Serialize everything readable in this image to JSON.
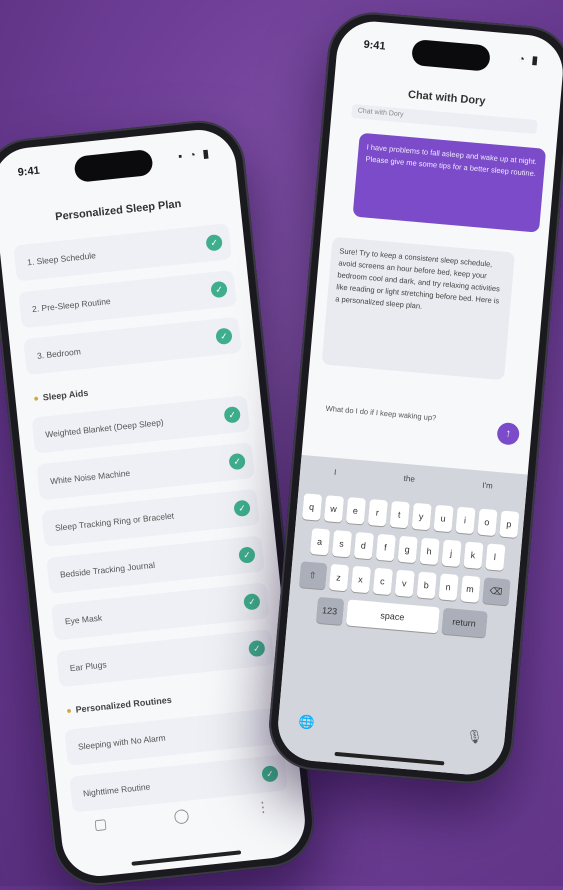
{
  "left_phone": {
    "status_time": "9:41",
    "status_icons": "▪ ◔ ▮",
    "title": "Personalized Sleep Plan",
    "checklist": [
      {
        "label": "1. Sleep Schedule",
        "checked": true
      },
      {
        "label": "2. Pre-Sleep Routine",
        "checked": true
      },
      {
        "label": "3. Bedroom",
        "checked": true
      }
    ],
    "section_1": "Sleep Aids",
    "aids": [
      {
        "label": "Weighted Blanket (Deep Sleep)",
        "checked": true
      },
      {
        "label": "White Noise Machine",
        "checked": true
      },
      {
        "label": "Sleep Tracking Ring or Bracelet",
        "checked": true
      },
      {
        "label": "Bedside Tracking Journal",
        "checked": true
      },
      {
        "label": "Eye Mask",
        "checked": true
      },
      {
        "label": "Ear Plugs",
        "checked": true
      }
    ],
    "section_2": "Personalized Routines",
    "routines": [
      {
        "label": "Sleeping with No Alarm",
        "checked": false
      },
      {
        "label": "Nighttime Routine",
        "checked": true
      }
    ],
    "nav_icons": [
      "home-icon",
      "chat-icon",
      "profile-icon"
    ]
  },
  "right_phone": {
    "status_time": "9:41",
    "status_icons": "◔ ▮",
    "title": "Chat with Dory",
    "sub_label": "Chat with Dory",
    "user_message": "I have problems to fall asleep and wake up at night. Please give me some tips for a better sleep routine.",
    "ai_message": "Sure! Try to keep a consistent sleep schedule, avoid screens an hour before bed, keep your bedroom cool and dark, and try relaxing activities like reading or light stretching before bed. Here is a personalized sleep plan.",
    "input_value": "What do I do if I keep waking up?",
    "send_glyph": "↑",
    "suggestions": [
      "I",
      "the",
      "I'm"
    ],
    "keys_row1": [
      "q",
      "w",
      "e",
      "r",
      "t",
      "y",
      "u",
      "i",
      "o",
      "p"
    ],
    "keys_row2": [
      "a",
      "s",
      "d",
      "f",
      "g",
      "h",
      "j",
      "k",
      "l"
    ],
    "keys_row3": [
      "z",
      "x",
      "c",
      "v",
      "b",
      "n",
      "m"
    ],
    "shift_glyph": "⇧",
    "delete_glyph": "⌫",
    "num_key": "123",
    "space_label": "space",
    "return_label": "return",
    "globe_glyph": "🌐",
    "mic_glyph": "🎙"
  },
  "colors": {
    "background": "#6f3f97",
    "accent": "#7b4bc9",
    "check": "#3fae8c"
  }
}
